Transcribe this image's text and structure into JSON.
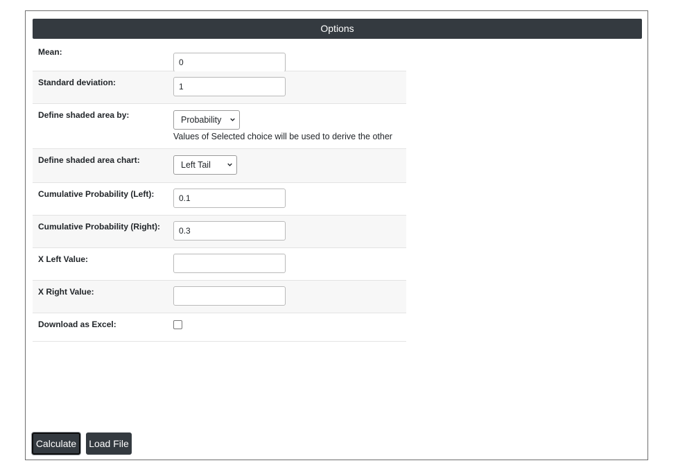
{
  "panel": {
    "title": "Options"
  },
  "form": {
    "mean": {
      "label": "Mean:",
      "value": "0"
    },
    "std_dev": {
      "label": "Standard deviation:",
      "value": "1"
    },
    "shaded_by": {
      "label": "Define shaded area by:",
      "selected": "Probability",
      "hint": "Values of Selected choice will be used to derive the other"
    },
    "shaded_chart": {
      "label": "Define shaded area chart:",
      "selected": "Left Tail"
    },
    "cum_prob_left": {
      "label": "Cumulative Probability (Left):",
      "value": "0.1"
    },
    "cum_prob_right": {
      "label": "Cumulative Probability (Right):",
      "value": "0.3"
    },
    "x_left": {
      "label": "X Left Value:",
      "value": ""
    },
    "x_right": {
      "label": "X Right Value:",
      "value": ""
    },
    "download_excel": {
      "label": "Download as Excel:",
      "checked": false
    }
  },
  "buttons": {
    "calculate": "Calculate",
    "load_file": "Load File"
  },
  "colors": {
    "header_bg": "#343a40",
    "button_bg": "#343a40",
    "row_alt_bg": "#f7f7f7"
  }
}
